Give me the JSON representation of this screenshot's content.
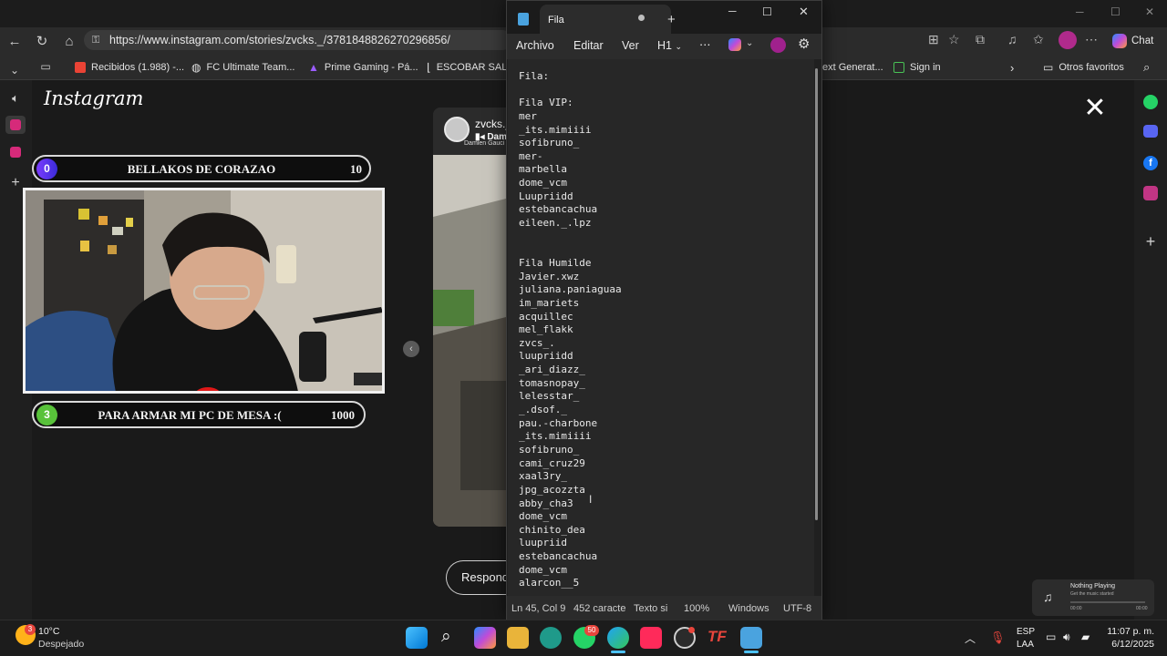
{
  "browser": {
    "url": "https://www.instagram.com/stories/zvcks._/3781848826270296856/",
    "bookmarks": [
      "Recibidos (1.988) -...",
      "FC Ultimate Team...",
      "Prime Gaming - Pá...",
      "ESCOBAR SALA",
      "ext Generat...",
      "Sign in"
    ],
    "other_favorites": "Otros favoritos",
    "chat_label": "Chat"
  },
  "instagram": {
    "logo": "Instagram",
    "story_user": "zvcks._",
    "story_music": "Dam",
    "story_music_artist": "Damien Gauci",
    "reply_placeholder": "Responde"
  },
  "stream_overlay": {
    "goal1": {
      "number": "0",
      "title": "BELLAKOS DE CORAZAO",
      "value": "10",
      "progress": 0.0
    },
    "goal2": {
      "number": "3",
      "title": "PARA ARMAR MI PC DE MESA :(",
      "value": "1000",
      "progress": 0.003
    }
  },
  "notepad": {
    "tab_title": "Fila",
    "menu": {
      "archivo": "Archivo",
      "editar": "Editar",
      "ver": "Ver",
      "heading": "H1"
    },
    "lines": [
      "Fila:",
      "",
      "Fila VIP:",
      "mer",
      "_its.mimiiii",
      "sofibruno_",
      "mer-",
      "marbella",
      "dome_vcm",
      "Luupriidd",
      "estebancachua",
      "eileen._.lpz",
      "",
      "",
      "Fila Humilde",
      "Javier.xwz",
      "juliana.paniaguaa",
      "im_mariets",
      "acquillec",
      "mel_flakk",
      "zvcs_.",
      "luupriidd",
      "_ari_diazz_",
      "tomasnopay_",
      "lelesstar_",
      "_.dsof._",
      "pau.-charbone",
      "_its.mimiiii",
      "sofibruno_",
      "cami_cruz29",
      "xaal3ry_",
      "jpg_acozzta",
      "abby_cha3",
      "dome_vcm",
      "chinito_dea",
      "luupriid",
      "estebancachua",
      "dome_vcm",
      "alarcon__5"
    ],
    "status": {
      "position": "Ln 45, Col 9",
      "chars": "452 caracte",
      "format": "Texto si",
      "zoom": "100%",
      "line_ending": "Windows",
      "encoding": "UTF-8"
    }
  },
  "taskbar": {
    "weather_temp": "10°C",
    "weather_desc": "Despejado",
    "weather_badge": "3",
    "whatsapp_badge": "50",
    "lang_top": "ESP",
    "lang_bottom": "LAA",
    "time": "11:07 p. m.",
    "date": "6/12/2025"
  },
  "media": {
    "title": "Nothing Playing",
    "subtitle": "Get the music started",
    "t_start": "00:00",
    "t_end": "00:00"
  }
}
